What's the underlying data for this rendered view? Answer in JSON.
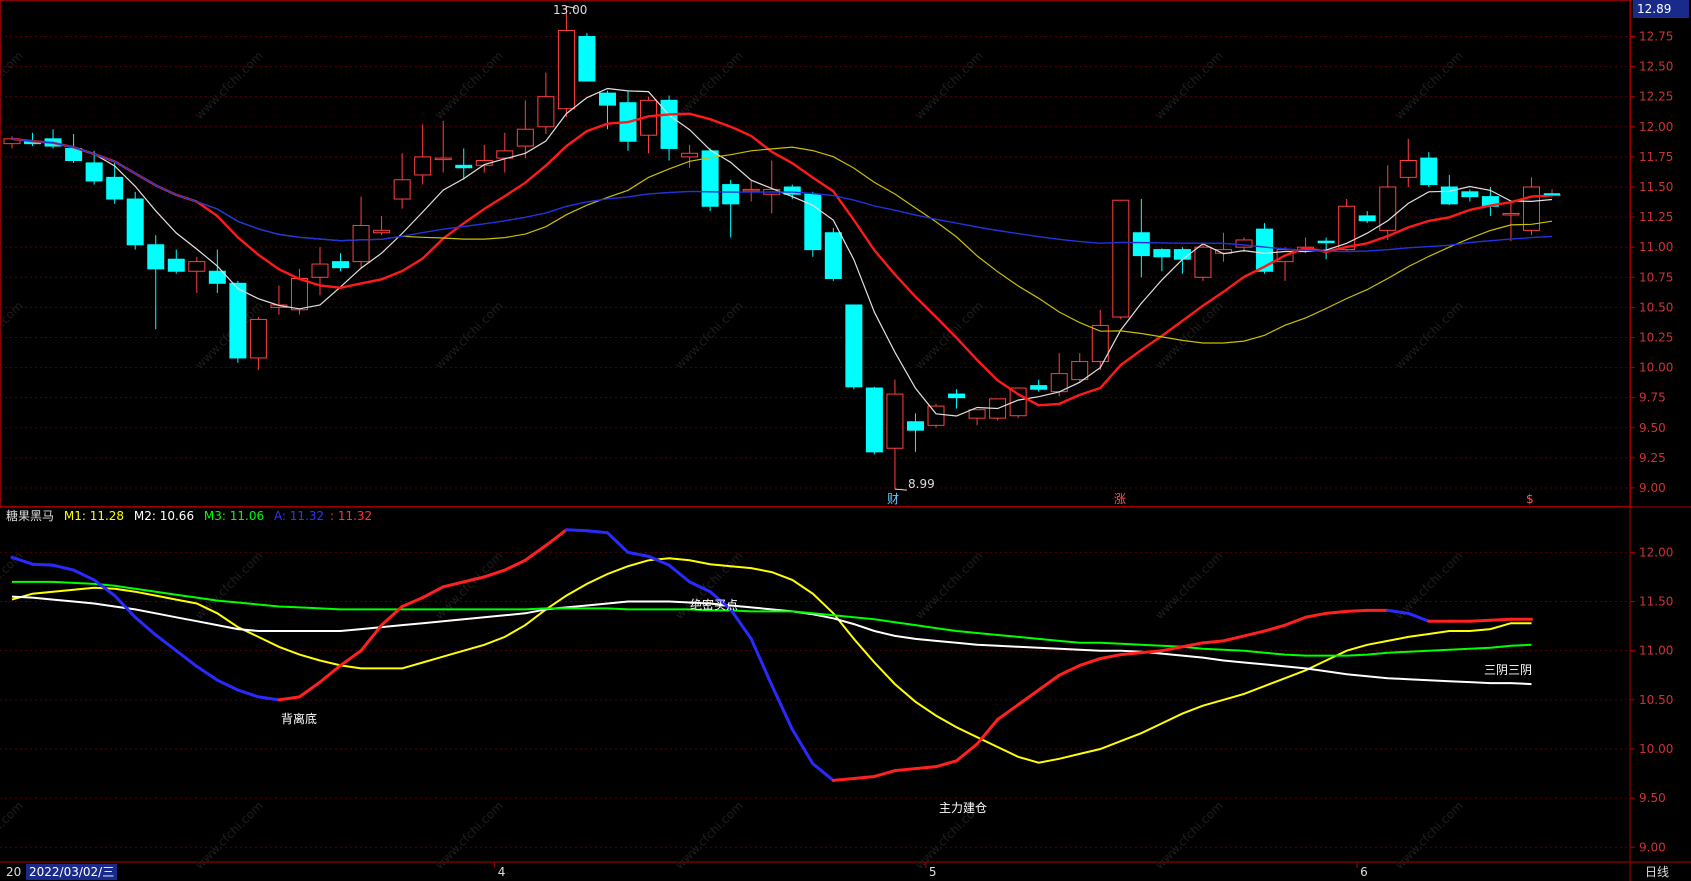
{
  "main_axis": {
    "ticks": [
      "12.75",
      "12.50",
      "12.25",
      "12.00",
      "11.75",
      "11.50",
      "11.25",
      "11.00",
      "10.75",
      "10.50",
      "10.25",
      "10.00",
      "9.75",
      "9.50",
      "9.25",
      "9.00"
    ],
    "current_price": "12.89"
  },
  "ind_axis": {
    "ticks": [
      "12.00",
      "11.50",
      "11.00",
      "10.50",
      "10.00",
      "9.50",
      "9.00"
    ]
  },
  "annotations": {
    "high": "13.00",
    "low": "8.99",
    "cai": "财",
    "zhang": "涨",
    "small": "$"
  },
  "indicator": {
    "name": "糖果黑马",
    "m1": "M1: 11.28",
    "m2": "M2: 10.66",
    "m3": "M3: 11.06",
    "a": "A: 11.32",
    "b": ": 11.32",
    "colors": {
      "m1": "#ffff00",
      "m2": "#ffffff",
      "m3": "#00ff00",
      "a": "#3333ff",
      "b": "#ff3333"
    }
  },
  "signals": {
    "beili": "背离底",
    "jueji": "绝密买点",
    "zhuli": "主力建仓",
    "sanyin": "三阴三阴"
  },
  "x_axis": {
    "start_date": "2022/03/02/三",
    "months": [
      "4",
      "5",
      "6"
    ],
    "period": "日线",
    "first": "20"
  },
  "watermark": "www.cfchi.com",
  "chart_data": {
    "type": "candlestick",
    "ylim": [
      8.9,
      13.02
    ],
    "candles": [
      [
        11.86,
        11.92,
        11.82,
        11.9
      ],
      [
        11.88,
        11.95,
        11.84,
        11.86
      ],
      [
        11.9,
        11.98,
        11.82,
        11.84
      ],
      [
        11.82,
        11.94,
        11.7,
        11.72
      ],
      [
        11.7,
        11.8,
        11.52,
        11.55
      ],
      [
        11.58,
        11.7,
        11.36,
        11.4
      ],
      [
        11.4,
        11.46,
        10.98,
        11.02
      ],
      [
        11.02,
        11.1,
        10.32,
        10.82
      ],
      [
        10.9,
        10.98,
        10.78,
        10.8
      ],
      [
        10.8,
        10.92,
        10.62,
        10.88
      ],
      [
        10.8,
        10.98,
        10.62,
        10.7
      ],
      [
        10.7,
        10.72,
        10.04,
        10.08
      ],
      [
        10.08,
        10.42,
        9.98,
        10.4
      ],
      [
        10.5,
        10.68,
        10.44,
        10.52
      ],
      [
        10.48,
        10.82,
        10.44,
        10.74
      ],
      [
        10.75,
        11.0,
        10.6,
        10.86
      ],
      [
        10.88,
        10.95,
        10.8,
        10.83
      ],
      [
        10.88,
        11.42,
        10.82,
        11.18
      ],
      [
        11.12,
        11.26,
        11.1,
        11.14
      ],
      [
        11.4,
        11.78,
        11.32,
        11.56
      ],
      [
        11.6,
        12.02,
        11.52,
        11.75
      ],
      [
        11.73,
        12.05,
        11.62,
        11.74
      ],
      [
        11.68,
        11.82,
        11.56,
        11.66
      ],
      [
        11.68,
        11.85,
        11.62,
        11.72
      ],
      [
        11.74,
        11.95,
        11.62,
        11.8
      ],
      [
        11.84,
        12.22,
        11.74,
        11.98
      ],
      [
        12.0,
        12.45,
        11.94,
        12.25
      ],
      [
        12.15,
        13.0,
        12.08,
        12.8
      ],
      [
        12.75,
        12.78,
        12.38,
        12.38
      ],
      [
        12.28,
        12.3,
        11.98,
        12.18
      ],
      [
        12.2,
        12.3,
        11.8,
        11.88
      ],
      [
        11.93,
        12.25,
        11.78,
        12.22
      ],
      [
        12.22,
        12.26,
        11.72,
        11.82
      ],
      [
        11.75,
        11.85,
        11.66,
        11.78
      ],
      [
        11.8,
        11.82,
        11.3,
        11.34
      ],
      [
        11.52,
        11.56,
        11.08,
        11.36
      ],
      [
        11.48,
        11.55,
        11.38,
        11.48
      ],
      [
        11.44,
        11.72,
        11.28,
        11.48
      ],
      [
        11.5,
        11.52,
        11.4,
        11.44
      ],
      [
        11.44,
        11.46,
        10.92,
        10.98
      ],
      [
        11.12,
        11.16,
        10.72,
        10.74
      ],
      [
        10.52,
        10.52,
        9.82,
        9.84
      ],
      [
        9.83,
        9.84,
        9.28,
        9.3
      ],
      [
        9.33,
        9.9,
        8.99,
        9.78
      ],
      [
        9.55,
        9.62,
        9.3,
        9.48
      ],
      [
        9.52,
        9.7,
        9.5,
        9.68
      ],
      [
        9.78,
        9.82,
        9.66,
        9.75
      ],
      [
        9.58,
        9.65,
        9.52,
        9.65
      ],
      [
        9.58,
        9.72,
        9.56,
        9.74
      ],
      [
        9.6,
        9.82,
        9.58,
        9.83
      ],
      [
        9.85,
        9.9,
        9.8,
        9.82
      ],
      [
        9.8,
        10.12,
        9.76,
        9.95
      ],
      [
        9.9,
        10.12,
        9.88,
        10.05
      ],
      [
        10.05,
        10.48,
        9.98,
        10.35
      ],
      [
        10.42,
        11.39,
        10.4,
        11.39
      ],
      [
        11.12,
        11.4,
        10.75,
        10.93
      ],
      [
        10.98,
        10.99,
        10.8,
        10.92
      ],
      [
        10.98,
        11.0,
        10.78,
        10.9
      ],
      [
        10.75,
        11.04,
        10.72,
        11.0
      ],
      [
        10.95,
        11.12,
        10.88,
        10.98
      ],
      [
        11.0,
        11.08,
        10.96,
        11.06
      ],
      [
        11.15,
        11.2,
        10.78,
        10.8
      ],
      [
        10.88,
        11.0,
        10.72,
        10.98
      ],
      [
        10.98,
        11.08,
        10.95,
        11.0
      ],
      [
        11.05,
        11.08,
        10.9,
        11.04
      ],
      [
        10.98,
        11.4,
        10.96,
        11.34
      ],
      [
        11.26,
        11.3,
        11.2,
        11.22
      ],
      [
        11.14,
        11.68,
        11.06,
        11.5
      ],
      [
        11.58,
        11.9,
        11.5,
        11.72
      ],
      [
        11.74,
        11.79,
        11.5,
        11.52
      ],
      [
        11.5,
        11.6,
        11.35,
        11.36
      ],
      [
        11.46,
        11.48,
        11.38,
        11.42
      ],
      [
        11.42,
        11.5,
        11.26,
        11.34
      ],
      [
        11.28,
        11.38,
        11.05,
        11.28
      ],
      [
        11.14,
        11.58,
        11.1,
        11.5
      ],
      [
        11.44,
        11.48,
        11.42,
        11.44
      ]
    ],
    "indicator_ylim": [
      8.85,
      12.35
    ],
    "indicator_series": [
      {
        "name": "M1",
        "values": [
          11.52,
          11.58,
          11.6,
          11.62,
          11.64,
          11.63,
          11.6,
          11.56,
          11.52,
          11.48,
          11.38,
          11.24,
          11.14,
          11.04,
          10.96,
          10.9,
          10.85,
          10.82,
          10.82,
          10.82,
          10.88,
          10.94,
          11.0,
          11.06,
          11.14,
          11.26,
          11.42,
          11.56,
          11.68,
          11.78,
          11.86,
          11.92,
          11.94,
          11.92,
          11.88,
          11.86,
          11.84,
          11.8,
          11.72,
          11.58,
          11.38,
          11.12,
          10.88,
          10.66,
          10.48,
          10.34,
          10.22,
          10.12,
          10.02,
          9.92,
          9.86,
          9.9,
          9.95,
          10.0,
          10.08,
          10.16,
          10.26,
          10.36,
          10.44,
          10.5,
          10.56,
          10.64,
          10.72,
          10.8,
          10.9,
          11.0,
          11.06,
          11.1,
          11.14,
          11.17,
          11.2,
          11.2,
          11.22,
          11.28,
          11.28
        ]
      },
      {
        "name": "M2",
        "values": [
          11.55,
          11.54,
          11.52,
          11.5,
          11.48,
          11.45,
          11.42,
          11.38,
          11.34,
          11.3,
          11.26,
          11.22,
          11.2,
          11.2,
          11.2,
          11.2,
          11.2,
          11.22,
          11.24,
          11.26,
          11.28,
          11.3,
          11.32,
          11.34,
          11.36,
          11.38,
          11.42,
          11.44,
          11.46,
          11.48,
          11.5,
          11.5,
          11.5,
          11.49,
          11.48,
          11.46,
          11.44,
          11.42,
          11.4,
          11.37,
          11.33,
          11.27,
          11.2,
          11.15,
          11.12,
          11.1,
          11.08,
          11.06,
          11.05,
          11.04,
          11.03,
          11.02,
          11.01,
          11.0,
          11.0,
          10.99,
          10.97,
          10.95,
          10.93,
          10.9,
          10.88,
          10.86,
          10.84,
          10.82,
          10.79,
          10.76,
          10.74,
          10.72,
          10.71,
          10.7,
          10.69,
          10.68,
          10.67,
          10.67,
          10.66
        ]
      },
      {
        "name": "M3",
        "values": [
          11.7,
          11.7,
          11.7,
          11.69,
          11.68,
          11.66,
          11.63,
          11.6,
          11.57,
          11.54,
          11.51,
          11.49,
          11.47,
          11.45,
          11.44,
          11.43,
          11.42,
          11.42,
          11.42,
          11.42,
          11.42,
          11.42,
          11.42,
          11.42,
          11.42,
          11.42,
          11.43,
          11.43,
          11.43,
          11.43,
          11.42,
          11.42,
          11.42,
          11.42,
          11.41,
          11.41,
          11.4,
          11.4,
          11.4,
          11.38,
          11.36,
          11.34,
          11.32,
          11.29,
          11.26,
          11.23,
          11.2,
          11.18,
          11.16,
          11.14,
          11.12,
          11.1,
          11.08,
          11.08,
          11.07,
          11.06,
          11.05,
          11.04,
          11.02,
          11.01,
          11.0,
          10.98,
          10.96,
          10.95,
          10.95,
          10.95,
          10.96,
          10.98,
          10.99,
          11.0,
          11.01,
          11.02,
          11.03,
          11.05,
          11.06
        ]
      },
      {
        "name": "A",
        "values": [
          11.95,
          11.88,
          11.87,
          11.82,
          11.72,
          11.56,
          11.34,
          11.16,
          11.0,
          10.84,
          10.7,
          10.6,
          10.53,
          10.5,
          10.53,
          10.68,
          10.85,
          11.0,
          11.26,
          11.45,
          11.54,
          11.65,
          11.7,
          11.75,
          11.82,
          11.92,
          12.07,
          12.23,
          12.22,
          12.2,
          12.0,
          11.96,
          11.87,
          11.7,
          11.6,
          11.42,
          11.12,
          10.65,
          10.2,
          9.85,
          9.68,
          9.7,
          9.72,
          9.78,
          9.8,
          9.82,
          9.88,
          10.05,
          10.3,
          10.45,
          10.6,
          10.75,
          10.85,
          10.92,
          10.96,
          10.98,
          11.0,
          11.04,
          11.08,
          11.1,
          11.15,
          11.2,
          11.26,
          11.34,
          11.38,
          11.4,
          11.41,
          11.41,
          11.38,
          11.3,
          11.3,
          11.3,
          11.31,
          11.32,
          11.32
        ]
      }
    ]
  }
}
